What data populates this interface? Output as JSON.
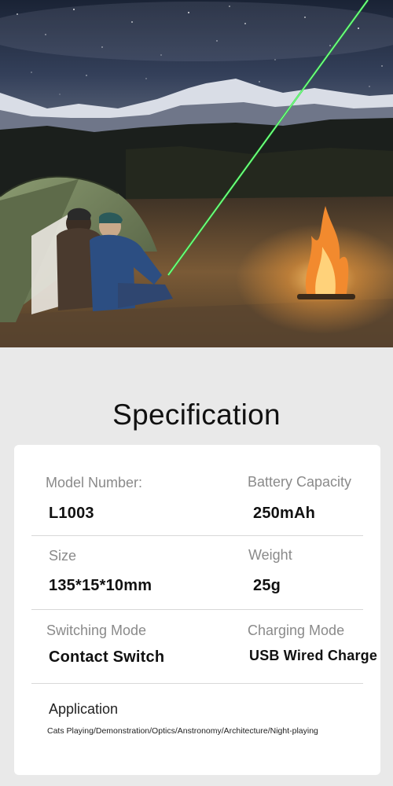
{
  "hero": {
    "image": "night-camping-laser-photo",
    "laser_color": "#35e64a"
  },
  "section_title": "Specification",
  "specs": [
    {
      "label": "Model Number:",
      "value": "L1003"
    },
    {
      "label": "Battery Capacity",
      "value": "250mAh"
    },
    {
      "label": "Size",
      "value": "135*15*10mm"
    },
    {
      "label": "Weight",
      "value": "25g"
    },
    {
      "label": "Switching Mode",
      "value": "Contact Switch"
    },
    {
      "label": "Charging Mode",
      "value": "USB Wired Charge"
    }
  ],
  "application": {
    "label": "Application",
    "value": "Cats Playing/Demonstration/Optics/Anstronomy/Architecture/Night-playing"
  }
}
